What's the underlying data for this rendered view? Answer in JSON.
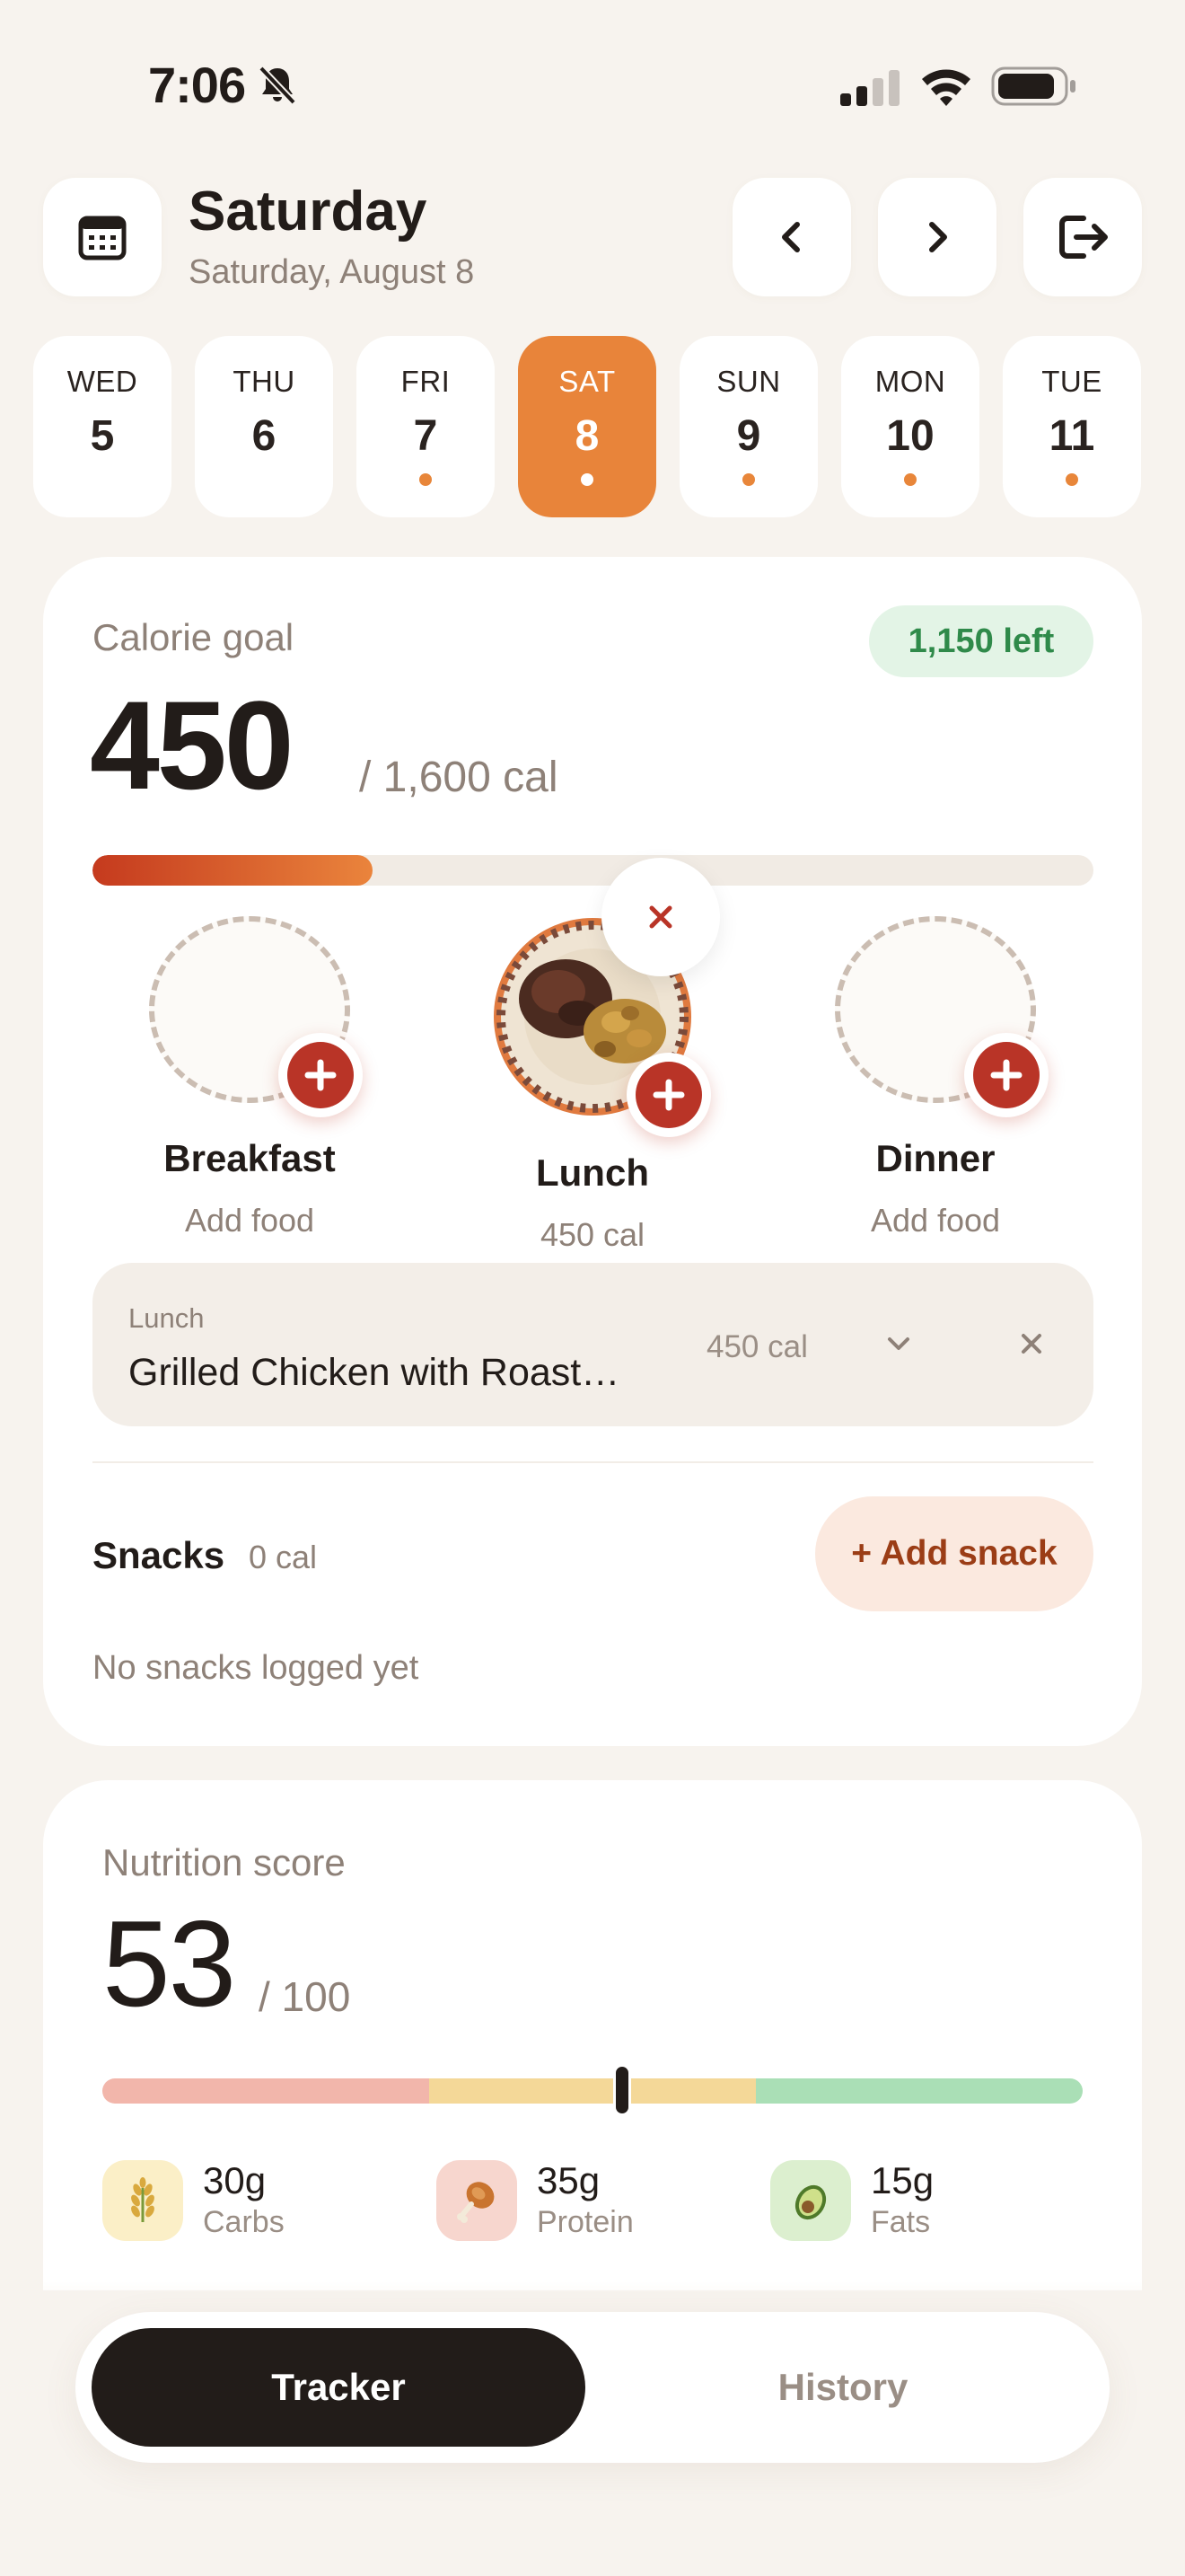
{
  "status_bar": {
    "time": "7:06"
  },
  "header": {
    "title": "Saturday",
    "subtitle": "Saturday, August 8"
  },
  "days": [
    {
      "name": "WED",
      "num": "5"
    },
    {
      "name": "THU",
      "num": "6"
    },
    {
      "name": "FRI",
      "num": "7"
    },
    {
      "name": "SAT",
      "num": "8"
    },
    {
      "name": "SUN",
      "num": "9"
    },
    {
      "name": "MON",
      "num": "10"
    },
    {
      "name": "TUE",
      "num": "11"
    }
  ],
  "calorie": {
    "label": "Calorie goal",
    "left_badge": "1,150 left",
    "value": "450",
    "total": "/ 1,600 cal",
    "progress": 0.28
  },
  "meals": [
    {
      "name": "Breakfast",
      "sub": "Add food"
    },
    {
      "name": "Lunch",
      "sub": "450 cal"
    },
    {
      "name": "Dinner",
      "sub": "Add food"
    }
  ],
  "logged_item": {
    "meal": "Lunch",
    "name": "Grilled Chicken with Roast…",
    "cal": "450 cal"
  },
  "snacks": {
    "title": "Snacks",
    "cal": "0 cal",
    "add_label": "+ Add snack",
    "empty": "No snacks logged yet"
  },
  "nutrition": {
    "label": "Nutrition score",
    "value": "53",
    "total": "/ 100",
    "score": 53,
    "colors": [
      "#f2b6ab",
      "#f4d898",
      "#aadfb6"
    ]
  },
  "macros": [
    {
      "value": "30g",
      "label": "Carbs",
      "icon": "rice-icon"
    },
    {
      "value": "35g",
      "label": "Protein",
      "icon": "drumstick-icon"
    },
    {
      "value": "15g",
      "label": "Fats",
      "icon": "avocado-icon"
    }
  ],
  "tabs": {
    "tracker": "Tracker",
    "history": "History"
  },
  "colors": {
    "accent": "#e8843a",
    "danger": "#b93427",
    "positive": "#2f8a4a"
  }
}
